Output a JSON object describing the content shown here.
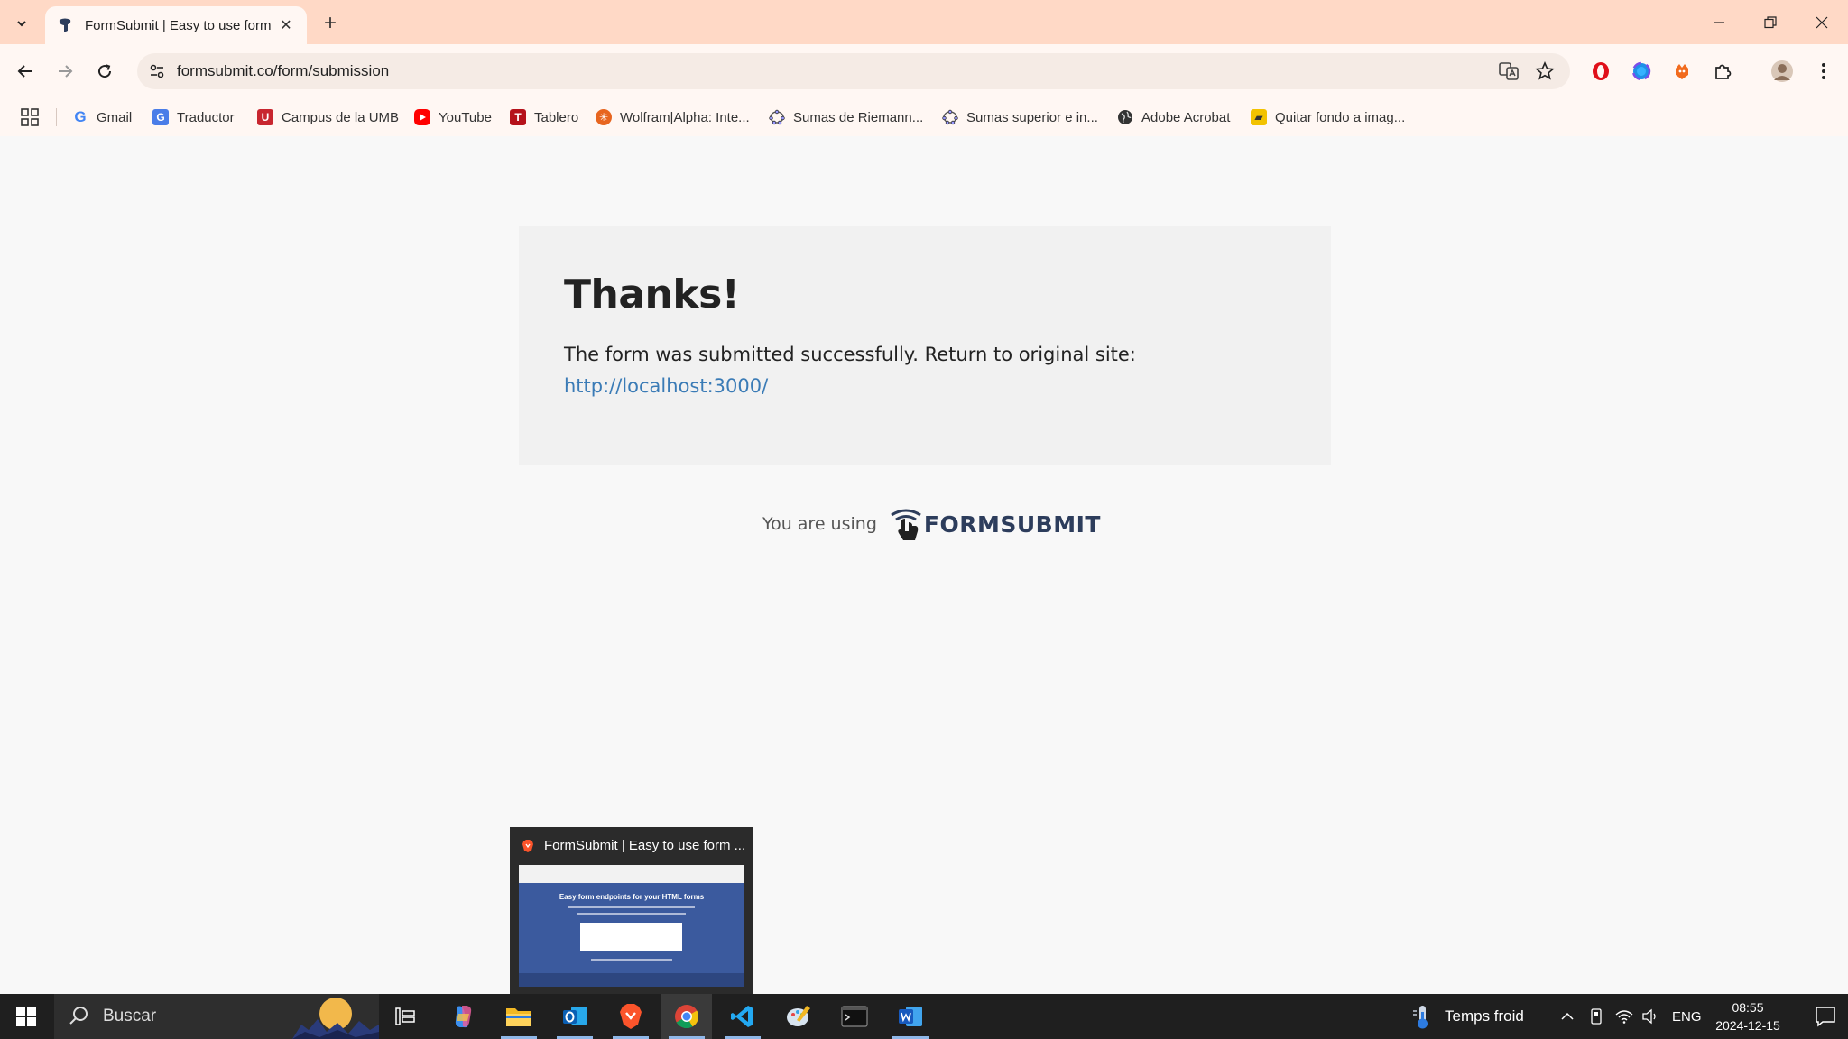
{
  "browser": {
    "tab": {
      "title": "FormSubmit | Easy to use form",
      "close": "✕"
    },
    "newtab": "+",
    "url": "formsubmit.co/form/submission",
    "bookmarks": [
      {
        "label": "Gmail",
        "icon": "google-icon",
        "color": "#4285f4"
      },
      {
        "label": "Traductor",
        "icon": "translate-icon",
        "color": "#4a7de8"
      },
      {
        "label": "Campus de la UMB",
        "icon": "umb-icon",
        "color": "#c8262f"
      },
      {
        "label": "YouTube",
        "icon": "youtube-icon",
        "color": "#ff0000"
      },
      {
        "label": "Tablero",
        "icon": "tablero-icon",
        "color": "#b5121b"
      },
      {
        "label": "Wolfram|Alpha: Inte...",
        "icon": "wolfram-icon",
        "color": "#e7651f"
      },
      {
        "label": "Sumas de Riemann...",
        "icon": "geogebra-icon",
        "color": "#666666"
      },
      {
        "label": "Sumas superior e in...",
        "icon": "geogebra-icon",
        "color": "#666666"
      },
      {
        "label": "Adobe Acrobat",
        "icon": "globe-icon",
        "color": "#333333"
      },
      {
        "label": "Quitar fondo a imag...",
        "icon": "removebg-icon",
        "color": "#f2c200"
      }
    ]
  },
  "page": {
    "heading": "Thanks!",
    "message": "The form was submitted successfully. Return to original site:",
    "link": "http://localhost:3000/",
    "using_text": "You are using",
    "brand": "FORMSUBMIT"
  },
  "preview": {
    "title": "FormSubmit | Easy to use form ...",
    "thumb_heading": "Easy form endpoints for your HTML forms"
  },
  "taskbar": {
    "search_placeholder": "Buscar",
    "weather": "Temps froid",
    "language": "ENG",
    "time": "08:55",
    "date": "2024-12-15"
  }
}
